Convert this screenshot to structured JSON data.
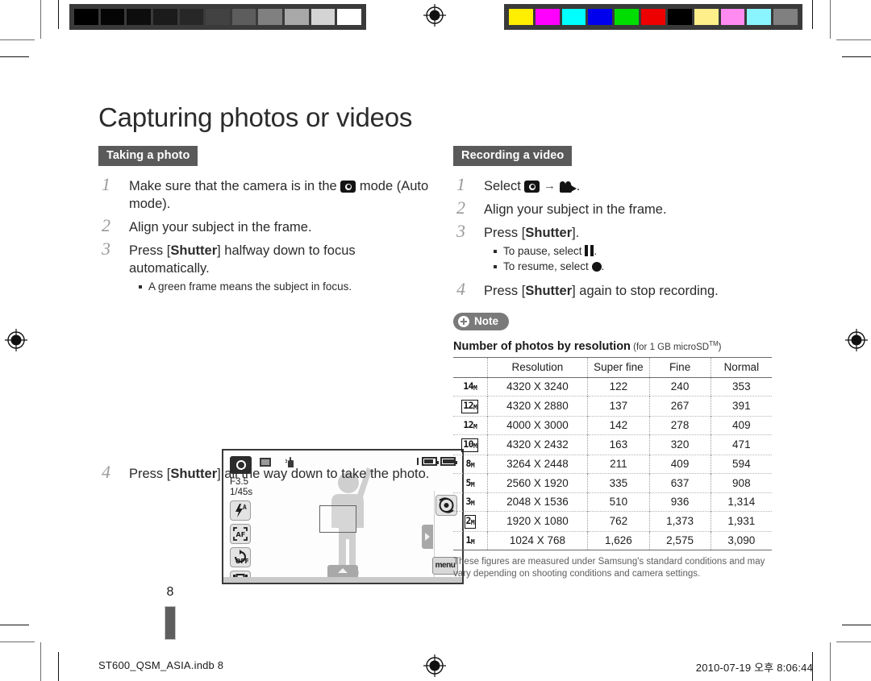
{
  "document": {
    "title": "Capturing photos or videos",
    "page_number": "8",
    "footer_file": "ST600_QSM_ASIA.indb   8",
    "footer_timestamp": "2010-07-19   오후 8:06:44"
  },
  "calibration": {
    "grayscale": [
      "#000000",
      "#050505",
      "#0d0d0d",
      "#1b1b1b",
      "#272727",
      "#424242",
      "#5d5d5d",
      "#808080",
      "#a8a8a8",
      "#d4d4d4",
      "#ffffff"
    ],
    "color": [
      "#ffee00",
      "#ff00ff",
      "#00ffff",
      "#0000ee",
      "#00dd00",
      "#ee0000",
      "#000000",
      "#ffef8a",
      "#ff8af0",
      "#8af4ff",
      "#808080"
    ]
  },
  "taking_photo": {
    "heading": "Taking a photo",
    "steps": [
      {
        "num": "1",
        "parts_before": "Make sure that the camera is in the ",
        "icon": "camera-icon",
        "parts_after": " mode (Auto mode)."
      },
      {
        "num": "2",
        "text": "Align your subject in the frame."
      },
      {
        "num": "3",
        "pre": "Press [",
        "key": "Shutter",
        "post": "] halfway down to focus automatically.",
        "bullets": [
          "A green frame means the subject in focus."
        ]
      },
      {
        "num": "4",
        "pre": "Press [",
        "key": "Shutter",
        "post": "] all the way down to take the photo."
      }
    ]
  },
  "recording_video": {
    "heading": "Recording a video",
    "steps": [
      {
        "num": "1",
        "pre": "Select ",
        "icon_a": "camera-icon",
        "arrow": "→",
        "icon_b": "camcorder-icon",
        "post": "."
      },
      {
        "num": "2",
        "text": "Align your subject in the frame."
      },
      {
        "num": "3",
        "pre": "Press [",
        "key": "Shutter",
        "post": "].",
        "bullets": [
          {
            "pre": "To pause, select ",
            "icon": "pause-icon",
            "post": "."
          },
          {
            "pre": "To resume, select ",
            "icon": "record-icon",
            "post": "."
          }
        ]
      },
      {
        "num": "4",
        "pre": "Press [",
        "key": "Shutter",
        "post": "] again to stop recording."
      }
    ]
  },
  "lcd_illustration": {
    "mode_icon": "camera-mode-icon",
    "frame_icon": "image-frame-icon",
    "hand_icon": "hand-shake-icon",
    "aperture": "F3.5",
    "shutter_speed": "1/45s",
    "left_buttons": [
      {
        "name": "flash-auto-button",
        "label": "A"
      },
      {
        "name": "focus-af-button",
        "label": "AF"
      },
      {
        "name": "timer-off-button",
        "label": "OFF"
      },
      {
        "name": "frame-guide-button",
        "label": ""
      }
    ],
    "right_button": "smart-filter-button",
    "menu_button": "menu",
    "battery_icon": "battery-icon",
    "memory_icon": "memory-card-icon"
  },
  "note": {
    "label": "Note",
    "caption_bold": "Number of photos by resolution",
    "caption_sub": "(for 1 GB microSD",
    "caption_sup": "TM",
    "caption_close": ")",
    "footnote": "These figures are measured under Samsung's standard conditions and may vary depending on shooting conditions and camera settings."
  },
  "chart_data": {
    "type": "table",
    "title": "Number of photos by resolution (for 1 GB microSD™)",
    "columns": [
      "",
      "Resolution",
      "Super fine",
      "Fine",
      "Normal"
    ],
    "rows": [
      {
        "icon": "14M",
        "boxed": false,
        "resolution": "4320 X 3240",
        "super_fine": "122",
        "fine": "240",
        "normal": "353"
      },
      {
        "icon": "12M",
        "boxed": true,
        "resolution": "4320 X 2880",
        "super_fine": "137",
        "fine": "267",
        "normal": "391"
      },
      {
        "icon": "12M",
        "boxed": false,
        "resolution": "4000 X 3000",
        "super_fine": "142",
        "fine": "278",
        "normal": "409"
      },
      {
        "icon": "10M",
        "boxed": true,
        "resolution": "4320 X 2432",
        "super_fine": "163",
        "fine": "320",
        "normal": "471"
      },
      {
        "icon": "8M",
        "boxed": false,
        "resolution": "3264 X 2448",
        "super_fine": "211",
        "fine": "409",
        "normal": "594"
      },
      {
        "icon": "5M",
        "boxed": false,
        "resolution": "2560 X 1920",
        "super_fine": "335",
        "fine": "637",
        "normal": "908"
      },
      {
        "icon": "3M",
        "boxed": false,
        "resolution": "2048 X 1536",
        "super_fine": "510",
        "fine": "936",
        "normal": "1,314"
      },
      {
        "icon": "2M",
        "boxed": true,
        "resolution": "1920 X 1080",
        "super_fine": "762",
        "fine": "1,373",
        "normal": "1,931"
      },
      {
        "icon": "1M",
        "boxed": false,
        "resolution": "1024 X 768",
        "super_fine": "1,626",
        "fine": "2,575",
        "normal": "3,090"
      }
    ]
  }
}
